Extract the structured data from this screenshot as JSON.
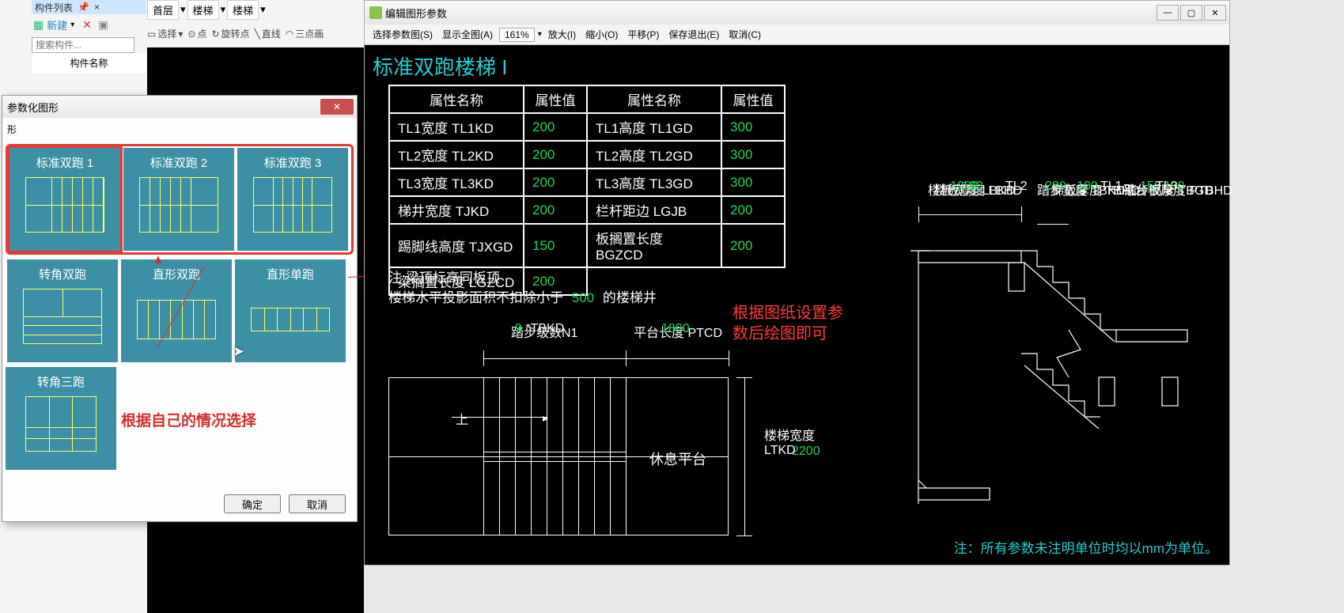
{
  "app": {
    "panel_title": "构件列表",
    "new_label": "新建",
    "search_placeholder": "搜索构件...",
    "column_header": "构件名称",
    "breadcrumb": [
      "首层",
      "楼梯",
      "楼梯"
    ]
  },
  "toolbar": {
    "select": "选择",
    "point": "点",
    "rotate": "旋转点",
    "line": "直线",
    "three_point": "三点画"
  },
  "param_dialog": {
    "title": "参数化图形",
    "subtitle": "形",
    "tiles": [
      "标准双跑 1",
      "标准双跑 2",
      "标准双跑 3",
      "转角双跑",
      "直形双跑",
      "直形单跑"
    ],
    "tile7": "转角三跑",
    "hint": "根据自己的情况选择",
    "ok": "确定",
    "cancel": "取消"
  },
  "editor": {
    "title": "编辑图形参数",
    "menu": {
      "select_param": "选择参数图(S)",
      "show_all": "显示全图(A)",
      "zoom": "161%",
      "zoom_in": "放大(I)",
      "zoom_out": "缩小(O)",
      "pan": "平移(P)",
      "save_exit": "保存退出(E)",
      "cancel": "取消(C)"
    },
    "canvas_title": "标准双跑楼梯 I",
    "table": {
      "headers": [
        "属性名称",
        "属性值",
        "属性名称",
        "属性值"
      ],
      "rows": [
        [
          "TL1宽度 TL1KD",
          "200",
          "TL1高度 TL1GD",
          "300"
        ],
        [
          "TL2宽度 TL2KD",
          "200",
          "TL2高度 TL2GD",
          "300"
        ],
        [
          "TL3宽度 TL3KD",
          "200",
          "TL3高度 TL3GD",
          "300"
        ],
        [
          "梯井宽度 TJKD",
          "200",
          "栏杆距边 LGJB",
          "200"
        ],
        [
          "踢脚线高度 TJXGD",
          "150",
          "板搁置长度 BGZCD",
          "200"
        ],
        [
          "梁搁置长度 LGZCD",
          "200",
          "",
          ""
        ]
      ]
    },
    "notes": {
      "line1": "注:梁顶标高同板顶",
      "line2a": "楼梯水平投影面积不扣除小于",
      "line2_val": "500",
      "line2b": "的楼梯井",
      "red": "根据图纸设置参数后绘图即可"
    },
    "plan": {
      "steps_n1": "踏步级数N1",
      "steps_val": "9",
      "steps_suffix": "*TBKD",
      "platform_len": "平台长度 PTCD",
      "platform_len_val": "1800",
      "stair_width": "楼梯宽度 LTKD",
      "stair_width_val": "2200",
      "up": "上",
      "rest_platform": "休息平台"
    },
    "section": {
      "slab_width": "楼板宽度 LBKD",
      "slab_width_val": "1200",
      "step_width": "踏步宽度 TBKD",
      "step_width_val": "280",
      "step_height": "踏步高度 TBGD",
      "step_height_val": "150",
      "slab_thick": "楼板厚度 LBHD",
      "slab_thick_val": "100",
      "plat_thick": "平台板厚度 PTBHD",
      "plat_thick_val": "100",
      "tl1": "TL1",
      "tl2": "TL2",
      "tl3": "TL3",
      "stair_thick": "梯板厚度 TBHD",
      "stair_thick_val": "100"
    },
    "footer": "注：所有参数未注明单位时均以mm为单位。"
  }
}
